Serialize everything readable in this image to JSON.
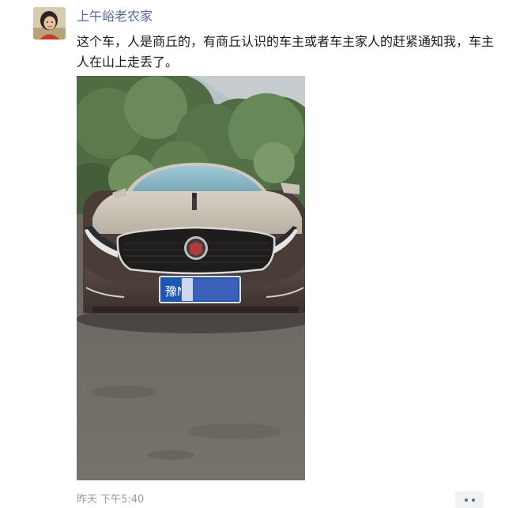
{
  "post": {
    "author": "上午峪老农家",
    "text": "这个车，人是商丘的，有商丘认识的车主或者车主家人的赶紧通知我，车主人在山上走丢了。",
    "photo": {
      "plate_visible": "豫N"
    },
    "time": "昨天 下午5:40"
  },
  "icons": {
    "avatar": "user-avatar-photo",
    "more": "more-dots-icon"
  },
  "colors": {
    "author_name": "#576b95",
    "body_text": "#1a1a1a",
    "timestamp": "#9a9a9a",
    "more_button_bg": "#f1f2f5"
  }
}
